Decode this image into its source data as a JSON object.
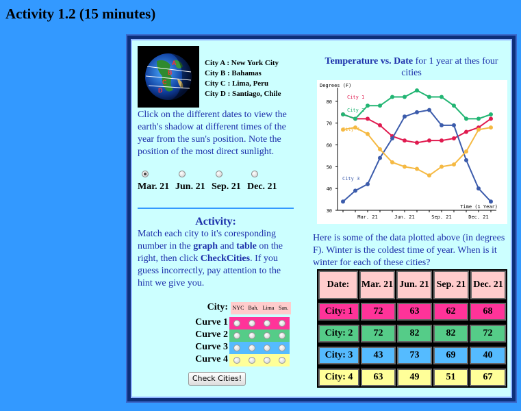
{
  "page_title": "Activity 1.2 (15 minutes)",
  "cities": [
    "City A : New York City",
    "City B : Bahamas",
    "City C : Lima, Peru",
    "City D : Santiago, Chile"
  ],
  "instructions": "Click on the different dates to view the earth's shadow at different times of the year from the sun's position. Note the position of the most direct sunlight.",
  "dates": {
    "selected": "Mar. 21",
    "options": [
      "Mar. 21",
      "Jun. 21",
      "Sep. 21",
      "Dec. 21"
    ]
  },
  "activity": {
    "title": "Activity:",
    "text_parts": [
      "Match each city to it's coresponding number in the ",
      "graph",
      " and ",
      "table",
      " on the right, then click ",
      "CheckCities",
      ". If you guess incorrectly, pay attention to the hint we give you."
    ],
    "city_label": "City:",
    "city_headers": [
      "NYC",
      "Bah.",
      "Lima",
      "San."
    ],
    "curves": [
      "Curve 1",
      "Curve 2",
      "Curve 3",
      "Curve 4"
    ],
    "check_button": "Check Cities!"
  },
  "chart_heading": {
    "bold": "Temperature vs. Date",
    "rest": " for 1 year at thes four cities"
  },
  "data_text": "Here is some of the data plotted above (in degrees F). Winter is the coldest time of year. When is it winter for each of these cities?",
  "table": {
    "header": [
      "Date:",
      "Mar. 21",
      "Jun. 21",
      "Sep. 21",
      "Dec. 21"
    ],
    "rows": [
      {
        "label": "City: 1",
        "values": [
          "72",
          "63",
          "62",
          "68"
        ]
      },
      {
        "label": "City: 2",
        "values": [
          "72",
          "82",
          "82",
          "72"
        ]
      },
      {
        "label": "City: 3",
        "values": [
          "43",
          "73",
          "69",
          "40"
        ]
      },
      {
        "label": "City: 4",
        "values": [
          "63",
          "49",
          "51",
          "67"
        ]
      }
    ]
  },
  "colors": {
    "city1": "#e01a4f",
    "city2": "#22b573",
    "city3": "#3b5bab",
    "city4": "#f5b942",
    "curve1_bg": "#ff3399",
    "curve2_bg": "#55cc88",
    "curve3_bg": "#55bbff",
    "curve4_bg": "#ffff99",
    "header_bg": "#ffcccc"
  },
  "chart_data": {
    "type": "line",
    "ylabel": "Degrees (F)",
    "xlabel": "Time (1 Year)",
    "ylim": [
      30,
      85
    ],
    "yticks": [
      30,
      40,
      50,
      60,
      70,
      80
    ],
    "xticks": [
      "Mar. 21",
      "Jun. 21",
      "Sep. 21",
      "Dec. 21"
    ],
    "grid": false,
    "series": [
      {
        "name": "City 1",
        "values": [
          74,
          72,
          72,
          69,
          64,
          62,
          61,
          62,
          62,
          63,
          66,
          68,
          72
        ]
      },
      {
        "name": "City 2",
        "values": [
          74,
          72,
          78,
          78,
          82,
          82,
          85,
          82,
          82,
          78,
          72,
          72,
          74
        ]
      },
      {
        "name": "City 3",
        "values": [
          34,
          39,
          42,
          54,
          63,
          73,
          75,
          76,
          69,
          69,
          53,
          40,
          34
        ]
      },
      {
        "name": "City 4",
        "values": [
          67,
          68,
          65,
          58,
          52,
          50,
          49,
          46,
          50,
          51,
          57,
          67,
          68
        ]
      }
    ]
  }
}
